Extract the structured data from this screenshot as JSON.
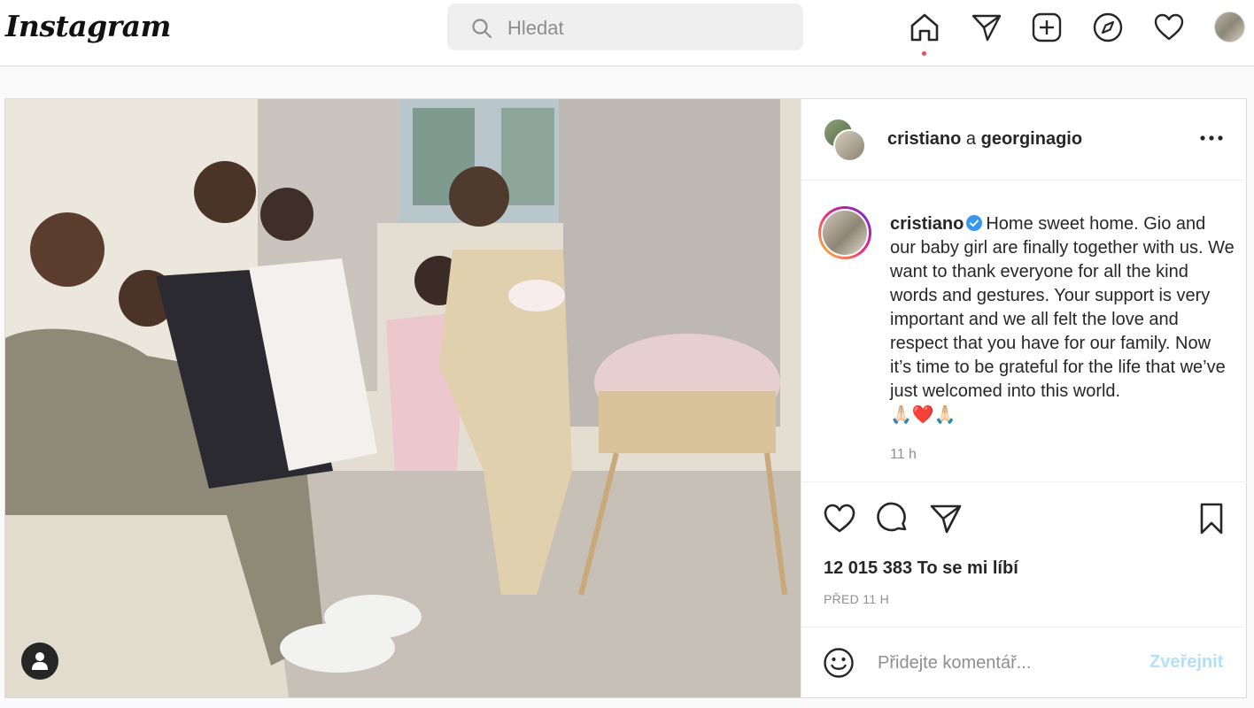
{
  "app": {
    "logo_text": "Instagram"
  },
  "search": {
    "placeholder": "Hledat"
  },
  "nav": {
    "icons": [
      "home-icon",
      "direct-icon",
      "new-post-icon",
      "explore-icon",
      "activity-heart-icon",
      "profile-avatar"
    ],
    "active": "home",
    "notification_dot_color": "#ed4956"
  },
  "post": {
    "header": {
      "user1": "cristiano",
      "joiner": "a",
      "user2": "georginagio"
    },
    "caption": {
      "username": "cristiano",
      "verified": true,
      "text": "Home sweet home. Gio and our baby girl are finally together with us. We want to thank everyone for all the kind words and gestures. Your support is very important and we all felt the love and respect that you have for our family. Now it’s time to be grateful for the life that we’ve just welcomed into this world.",
      "emojis": "🙏🏻❤️🙏🏻",
      "time": "11 h"
    },
    "likes_text": "12 015 383 To se mi líbí",
    "posted_ago": "PŘED 11 H",
    "comment": {
      "placeholder": "Přidejte komentář...",
      "publish_label": "Zveřejnit"
    }
  },
  "colors": {
    "link_blue_disabled": "#b2dffc",
    "verified_blue": "#3897f0",
    "text": "#262626",
    "muted": "#8e8e8e"
  }
}
